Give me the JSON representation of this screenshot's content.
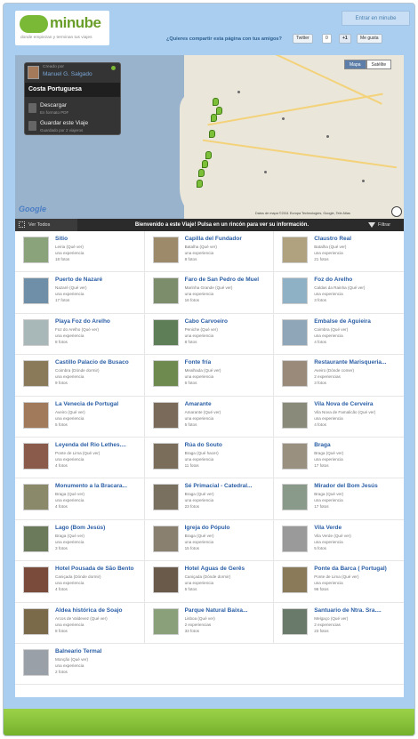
{
  "header": {
    "logo_text": "minube",
    "tagline": "donde empiezan y terminan tus viajes",
    "login_label": "Entrar en minube",
    "share_prompt": "¿Quieres compartir esta página con tus amigos?",
    "twitter_label": "Twitter",
    "twitter_count": "0",
    "gplus_label": "+1",
    "facebook_label": "Me gusta"
  },
  "map": {
    "type_map": "Mapa",
    "type_satellite": "Satélite",
    "copyright": "Datos de mapa ©2011 Europa Technologies, Google, Tele Atlas",
    "google_logo": "Google"
  },
  "trip_panel": {
    "created_by": "Creado por",
    "author": "Manuel G. Salgado",
    "title": "Costa Portuguesa",
    "download_label": "Descargar",
    "download_sub": "En formato PDF",
    "save_label": "Guardar este Viaje",
    "save_sub": "Guardado por 2 viajeros"
  },
  "toolbar": {
    "view_all": "Ver Todos",
    "welcome": "Bienvenido a este Viaje! Pulsa en un rincón para ver su información.",
    "filter": "Filtrar"
  },
  "places": [
    {
      "name": "Sitio",
      "loc": "Leiria (Qué ver)",
      "exp": "una experiencia",
      "photos": "18 fotos",
      "color": "#8aa37a"
    },
    {
      "name": "Capilla del Fundador",
      "loc": "Batalha (Qué ver)",
      "exp": "una experiencia",
      "photos": "8 fotos",
      "color": "#9c8a6a"
    },
    {
      "name": "Claustro Real",
      "loc": "Batalha (Qué ver)",
      "exp": "una experiencia",
      "photos": "21 fotos",
      "color": "#b0a27e"
    },
    {
      "name": "Puerto de Nazaré",
      "loc": "Nazaré (Qué ver)",
      "exp": "una experiencia",
      "photos": "17 fotos",
      "color": "#6f8fa8"
    },
    {
      "name": "Faro de San Pedro de Muel",
      "loc": "Marinha Grande (Qué ver)",
      "exp": "una experiencia",
      "photos": "16 fotos",
      "color": "#7c8d6c"
    },
    {
      "name": "Foz do Arelho",
      "loc": "Caldas da Rainha (Qué ver)",
      "exp": "una experiencia",
      "photos": "3 fotos",
      "color": "#8fb1c6"
    },
    {
      "name": "Playa Foz do Arelho",
      "loc": "Foz do Arelho (Qué ver)",
      "exp": "una experiencia",
      "photos": "8 fotos",
      "color": "#a8b8b8"
    },
    {
      "name": "Cabo Carvoeiro",
      "loc": "Peniche (Qué ver)",
      "exp": "una experiencia",
      "photos": "8 fotos",
      "color": "#5e7e58"
    },
    {
      "name": "Embalse de Aguieira",
      "loc": "Coimbra (Qué ver)",
      "exp": "una experiencia",
      "photos": "4 fotos",
      "color": "#8ea6b8"
    },
    {
      "name": "Castillo Palacio de Busaco",
      "loc": "Coimbra (Dónde dormir)",
      "exp": "una experiencia",
      "photos": "9 fotos",
      "color": "#8b7a5a"
    },
    {
      "name": "Fonte fría",
      "loc": "Mealhada (Qué ver)",
      "exp": "una experiencia",
      "photos": "6 fotos",
      "color": "#6e8a4e"
    },
    {
      "name": "Restaurante Marisqueria...",
      "loc": "Aveiro (Dónde comer)",
      "exp": "2 experiencias",
      "photos": "3 fotos",
      "color": "#9a8a7a"
    },
    {
      "name": "La Venecia de Portugal",
      "loc": "Aveiro (Qué ver)",
      "exp": "una experiencia",
      "photos": "5 fotos",
      "color": "#a07a5a"
    },
    {
      "name": "Amarante",
      "loc": "Amarante (Qué ver)",
      "exp": "una experiencia",
      "photos": "5 fotos",
      "color": "#7a6a5a"
    },
    {
      "name": "Vila Nova de Cerveira",
      "loc": "Vila Nova de Famalicão (Qué ver)",
      "exp": "una experiencia",
      "photos": "4 fotos",
      "color": "#8a8a7a"
    },
    {
      "name": "Leyenda del Rio Lethes....",
      "loc": "Ponte de Lima (Qué ver)",
      "exp": "una experiencia",
      "photos": "4 fotos",
      "color": "#8a5a4a"
    },
    {
      "name": "Rúa do Souto",
      "loc": "Braga (Qué hacer)",
      "exp": "una experiencia",
      "photos": "11 fotos",
      "color": "#7a6e5a"
    },
    {
      "name": "Braga",
      "loc": "Braga (Qué ver)",
      "exp": "una experiencia",
      "photos": "17 fotos",
      "color": "#9a9080"
    },
    {
      "name": "Monumento a la Bracara...",
      "loc": "Braga (Qué ver)",
      "exp": "una experiencia",
      "photos": "4 fotos",
      "color": "#8a8a6a"
    },
    {
      "name": "Sé Primacial - Catedral...",
      "loc": "Braga (Qué ver)",
      "exp": "una experiencia",
      "photos": "23 fotos",
      "color": "#7a7060"
    },
    {
      "name": "Mirador del Bom Jesús",
      "loc": "Braga (Qué ver)",
      "exp": "una experiencia",
      "photos": "17 fotos",
      "color": "#8a9a8a"
    },
    {
      "name": "Lago (Bom Jesús)",
      "loc": "Braga (Qué ver)",
      "exp": "una experiencia",
      "photos": "3 fotos",
      "color": "#6a7a5a"
    },
    {
      "name": "Igreja do Pópulo",
      "loc": "Braga (Qué ver)",
      "exp": "una experiencia",
      "photos": "15 fotos",
      "color": "#8a8070"
    },
    {
      "name": "Vila Verde",
      "loc": "Vila Verde (Qué ver)",
      "exp": "una experiencia",
      "photos": "5 fotos",
      "color": "#9a9a9a"
    },
    {
      "name": "Hotel Pousada de São Bento",
      "loc": "Caniçada (Dónde dormir)",
      "exp": "una experiencia",
      "photos": "4 fotos",
      "color": "#7a4a3a"
    },
    {
      "name": "Hotel Águas de Gerês",
      "loc": "Caniçada (Dónde dormir)",
      "exp": "una experiencia",
      "photos": "5 fotos",
      "color": "#6a5a4a"
    },
    {
      "name": "Ponte da Barca ( Portugal)",
      "loc": "Ponte de Lima (Qué ver)",
      "exp": "una experiencia",
      "photos": "96 fotos",
      "color": "#8a7a5a"
    },
    {
      "name": "Aldea histórica de Soajo",
      "loc": "Arcos de Valdevez (Qué ver)",
      "exp": "una experiencia",
      "photos": "8 fotos",
      "color": "#7a6a4a"
    },
    {
      "name": "Parque Natural Baixa...",
      "loc": "Lisboa (Qué ver)",
      "exp": "2 experiencias",
      "photos": "33 fotos",
      "color": "#8aa07a"
    },
    {
      "name": "Santuario de Ntra. Sra....",
      "loc": "Melgaço (Qué ver)",
      "exp": "2 experiencias",
      "photos": "23 fotos",
      "color": "#6a7a6a"
    },
    {
      "name": "Balneario Termal",
      "loc": "Monção (Qué ver)",
      "exp": "una experiencia",
      "photos": "2 fotos",
      "color": "#9aa0a8"
    }
  ]
}
